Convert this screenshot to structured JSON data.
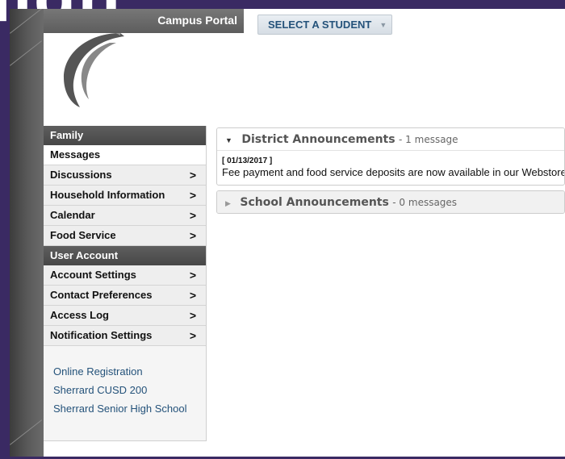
{
  "header": {
    "portal_title": "Campus Portal",
    "select_student_label": "SELECT A STUDENT",
    "caret": "▼"
  },
  "sidebar": {
    "section_family": "Family",
    "family_items": [
      {
        "label": "Messages",
        "active": true
      },
      {
        "label": "Discussions",
        "chevron": ">"
      },
      {
        "label": "Household Information",
        "chevron": ">"
      },
      {
        "label": "Calendar",
        "chevron": ">"
      },
      {
        "label": "Food Service",
        "chevron": ">"
      }
    ],
    "section_user": "User Account",
    "user_items": [
      {
        "label": "Account Settings",
        "chevron": ">"
      },
      {
        "label": "Contact Preferences",
        "chevron": ">"
      },
      {
        "label": "Access Log",
        "chevron": ">"
      },
      {
        "label": "Notification Settings",
        "chevron": ">"
      }
    ],
    "links": [
      {
        "label": "Online Registration"
      },
      {
        "label": "Sherrard CUSD 200"
      },
      {
        "label": "Sherrard Senior High School"
      }
    ]
  },
  "main": {
    "district": {
      "title": "District Announcements",
      "count": " - 1 message",
      "message_date": "[ 01/13/2017 ]",
      "message_text": "Fee payment and food service deposits are now available in our Webstore."
    },
    "school": {
      "title": "School Announcements",
      "count": " - 0 messages"
    }
  },
  "colors": {
    "frame": "#3a2a63",
    "link": "#24527a",
    "section_header": "#4f4f4f"
  }
}
